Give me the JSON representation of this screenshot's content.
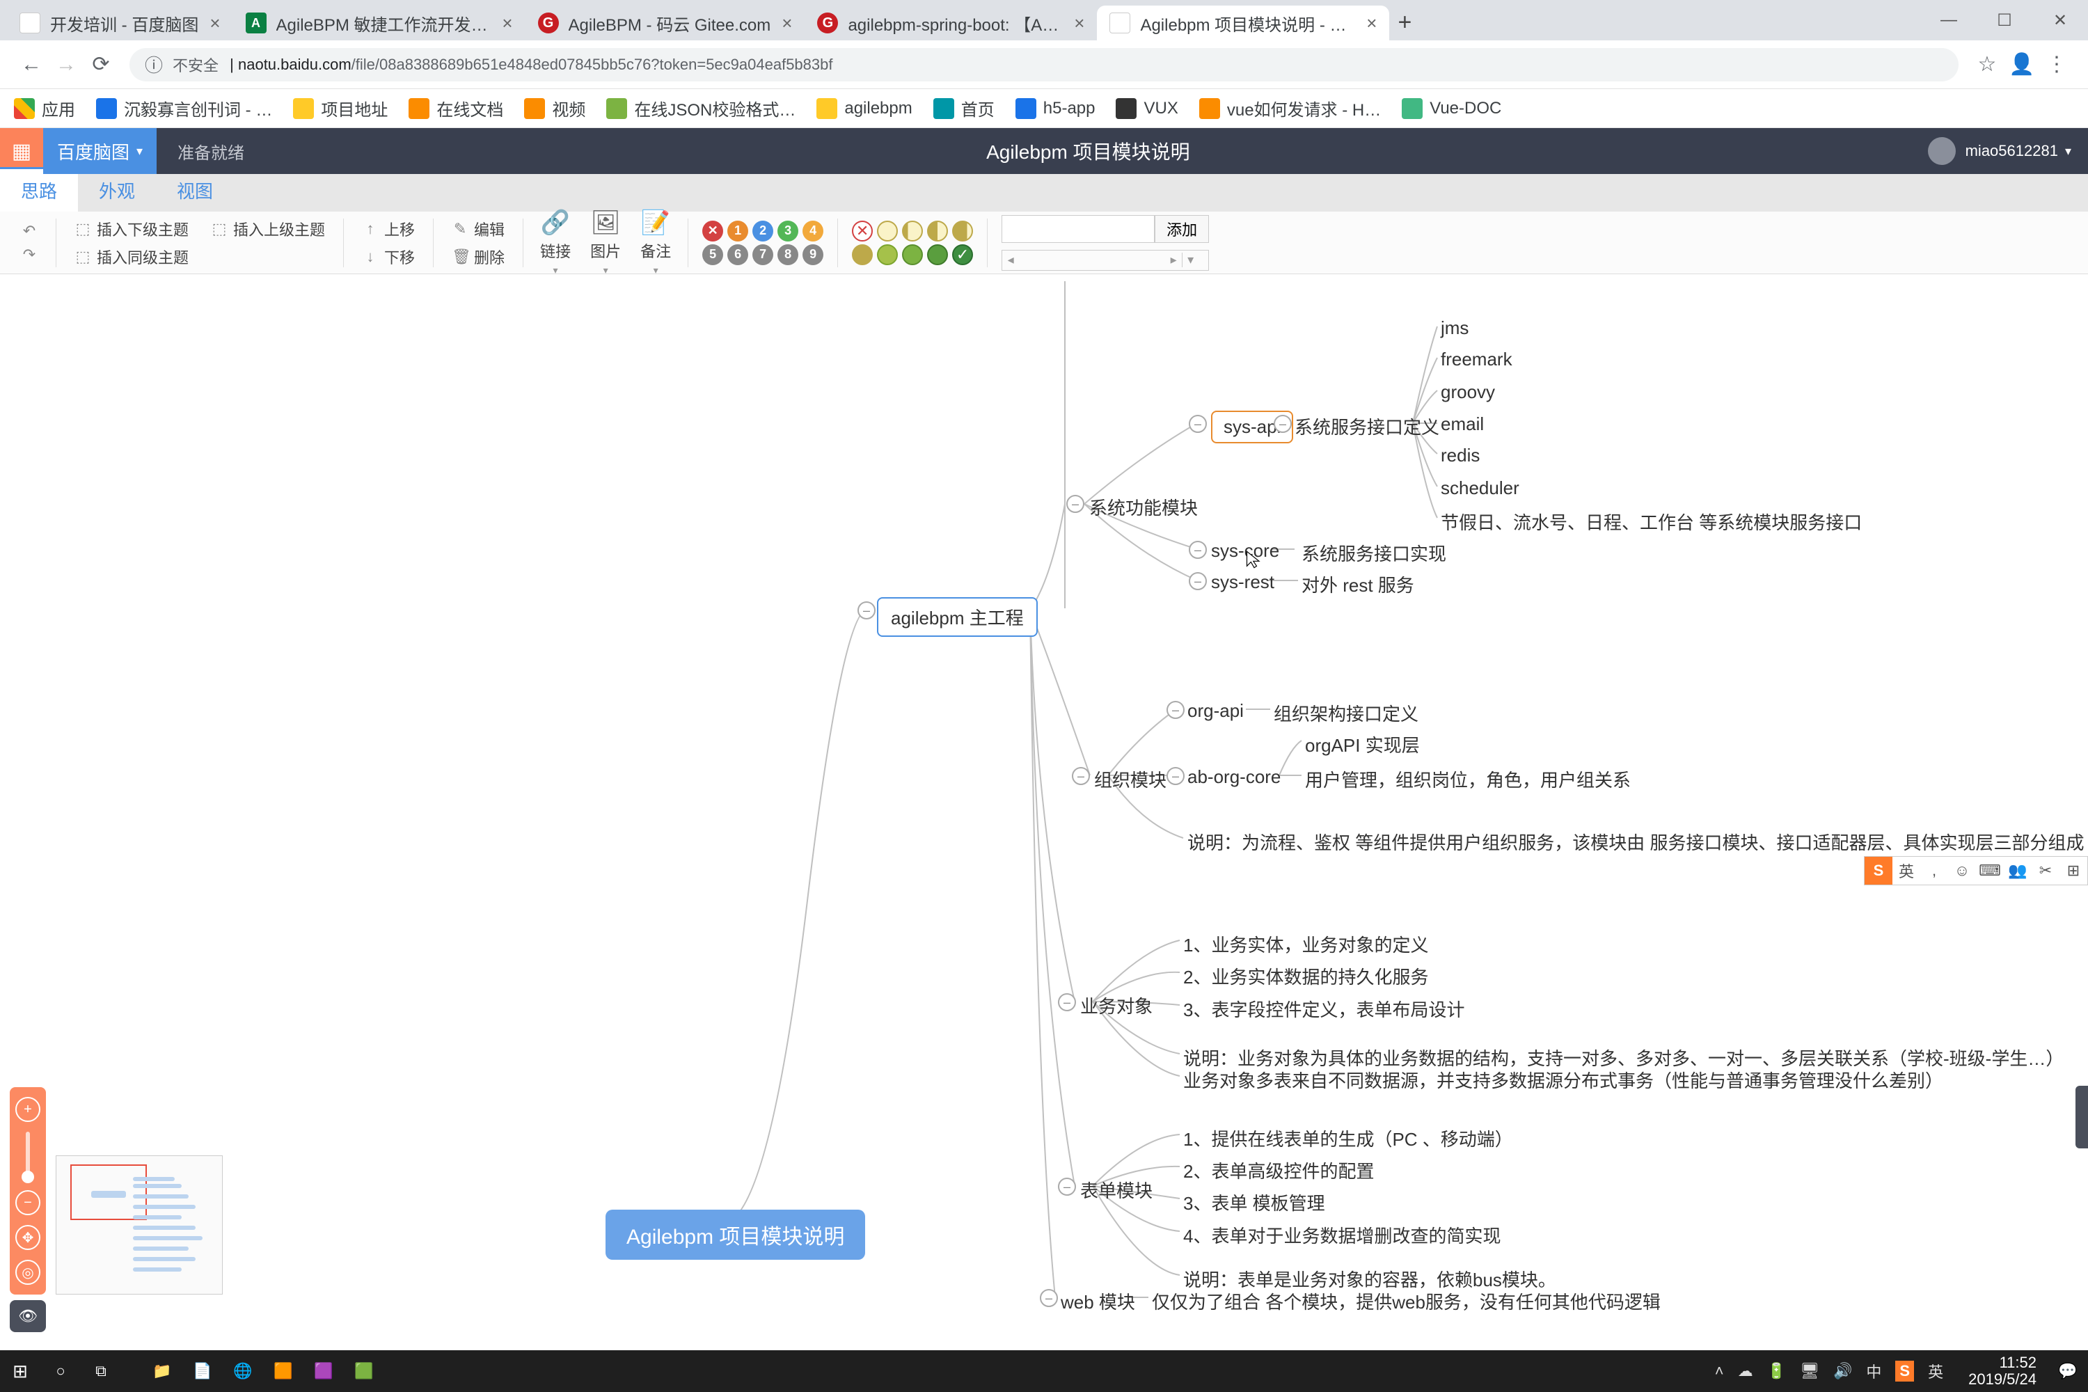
{
  "tabs": [
    {
      "label": "开发培训 - 百度脑图",
      "fav": "b"
    },
    {
      "label": "AgileBPM 敏捷工作流开发平…",
      "fav": "a"
    },
    {
      "label": "AgileBPM - 码云 Gitee.com",
      "fav": "g"
    },
    {
      "label": "agilebpm-spring-boot: 【Agile…",
      "fav": "g"
    },
    {
      "label": "Agilebpm 项目模块说明 - 百度…",
      "fav": "b",
      "active": true
    }
  ],
  "omnibox": {
    "insecure": "不安全",
    "host": "naotu.baidu.com",
    "path": "/file/08a8388689b651e4848ed07845bb5c76?token=5ec9a04eaf5b83bf"
  },
  "bookmarks": [
    {
      "label": "应用",
      "icon": "apps"
    },
    {
      "label": "沉毅寡言创刊词 - …",
      "icon": "blue"
    },
    {
      "label": "项目地址",
      "icon": "folder"
    },
    {
      "label": "在线文档",
      "icon": "orange"
    },
    {
      "label": "视频",
      "icon": "orange"
    },
    {
      "label": "在线JSON校验格式…",
      "icon": "green"
    },
    {
      "label": "agilebpm",
      "icon": "folder"
    },
    {
      "label": "首页",
      "icon": "teal"
    },
    {
      "label": "h5-app",
      "icon": "blue"
    },
    {
      "label": "VUX",
      "icon": ""
    },
    {
      "label": "vue如何发请求 - H…",
      "icon": "orange"
    },
    {
      "label": "Vue-DOC",
      "icon": ""
    }
  ],
  "app": {
    "brand": "百度脑图",
    "status": "准备就绪",
    "docTitle": "Agilebpm 项目模块说明",
    "user": "miao5612281"
  },
  "ribbon": {
    "tabs": [
      "思路",
      "外观",
      "视图"
    ],
    "active": 0
  },
  "toolbar": {
    "insertChild": "插入下级主题",
    "insertParent": "插入上级主题",
    "insertSibling": "插入同级主题",
    "moveUp": "上移",
    "moveDown": "下移",
    "edit": "编辑",
    "delete": "删除",
    "link": "链接",
    "image": "图片",
    "note": "备注",
    "priorityRow1": [
      "✕",
      "1",
      "2",
      "3",
      "4"
    ],
    "priorityColors1": [
      "#d34141",
      "#e98b2e",
      "#4a90e2",
      "#53b757",
      "#f2a93b"
    ],
    "priorityRow2": [
      "5",
      "6",
      "7",
      "8",
      "9"
    ],
    "searchBtn": "添加"
  },
  "mindmap": {
    "root": "Agilebpm 项目模块说明",
    "center": "agilebpm 主工程",
    "sysModule": "系统功能模块",
    "sysApi": "sys-api",
    "sysApiDesc": "系统服务接口定义",
    "sysApiChildren": [
      "jms",
      "freemark",
      "groovy",
      "email",
      "redis",
      "scheduler",
      "节假日、流水号、日程、工作台 等系统模块服务接口"
    ],
    "sysCore": "sys-core",
    "sysCoreDesc": "系统服务接口实现",
    "sysRest": "sys-rest",
    "sysRestDesc": "对外 rest 服务",
    "orgModule": "组织模块",
    "orgApi": "org-api",
    "orgApiDesc": "组织架构接口定义",
    "abOrgCore": "ab-org-core",
    "abOrgCoreC1": "orgAPI 实现层",
    "abOrgCoreC2": "用户管理，组织岗位，角色，用户组关系",
    "orgNote": "说明：为流程、鉴权 等组件提供用户组织服务，该模块由 服务接口模块、接口适配器层、具体实现层三部分组成",
    "bizObj": "业务对象",
    "bizObjItems": [
      "1、业务实体，业务对象的定义",
      "2、业务实体数据的持久化服务",
      "3、表字段控件定义，表单布局设计"
    ],
    "bizObjNote1": "说明：业务对象为具体的业务数据的结构，支持一对多、多对多、一对一、多层关联关系（学校-班级-学生…）",
    "bizObjNote2": "业务对象多表来自不同数据源，并支持多数据源分布式事务（性能与普通事务管理没什么差别）",
    "formModule": "表单模块",
    "formItems": [
      "1、提供在线表单的生成（PC 、移动端）",
      "2、表单高级控件的配置",
      "3、表单 模板管理",
      "4、表单对于业务数据增删改查的简实现"
    ],
    "formNote": "说明：表单是业务对象的容器，依赖bus模块。",
    "webModule": "web 模块",
    "webModuleDesc": "仅仅为了组合 各个模块，提供web服务，没有任何其他代码逻辑"
  },
  "ime": [
    "S",
    "英",
    ",",
    "☺",
    "⌨",
    "👥",
    "✂",
    "⊞"
  ],
  "tray": {
    "time": "11:52",
    "date": "2019/5/24",
    "ime1": "中",
    "ime2": "英"
  }
}
